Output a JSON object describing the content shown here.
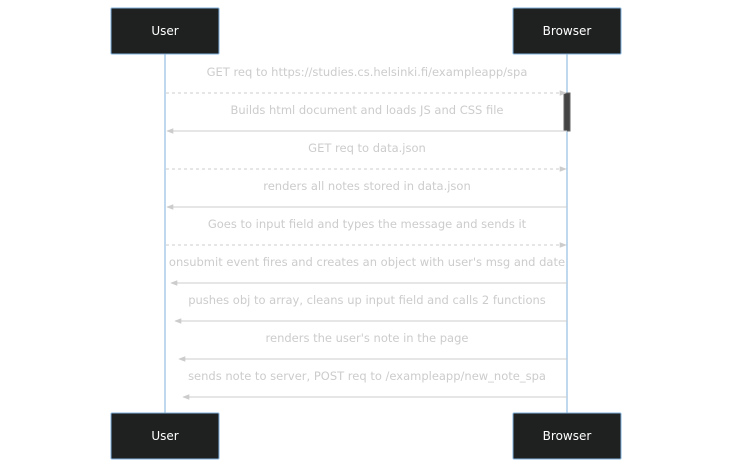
{
  "participants": [
    {
      "id": "user",
      "label": "User"
    },
    {
      "id": "browser",
      "label": "Browser"
    }
  ],
  "messages": [
    {
      "from": "user",
      "to": "browser",
      "style": "dotted",
      "text": "GET req to https://studies.cs.helsinki.fi/exampleapp/spa"
    },
    {
      "from": "browser",
      "to": "user",
      "style": "solid",
      "text": "Builds html document and loads JS and CSS file"
    },
    {
      "from": "user",
      "to": "browser",
      "style": "dotted",
      "text": "GET req to data.json"
    },
    {
      "from": "browser",
      "to": "user",
      "style": "solid",
      "text": "renders all notes stored in data.json"
    },
    {
      "from": "user",
      "to": "browser",
      "style": "dotted",
      "text": "Goes to input field and types the message and sends it"
    },
    {
      "from": "browser",
      "to": "user",
      "style": "solid",
      "text": "onsubmit event fires and creates an object with user's msg and date"
    },
    {
      "from": "browser",
      "to": "user",
      "style": "solid",
      "text": "pushes obj to array, cleans up input field and calls 2 functions"
    },
    {
      "from": "browser",
      "to": "user",
      "style": "solid",
      "text": "renders the user's note in the page"
    },
    {
      "from": "browser",
      "to": "user",
      "style": "solid",
      "text": "sends note to server, POST req to /exampleapp/new_note_spa"
    }
  ],
  "activation": {
    "participant": "browser",
    "from_message": 0,
    "to_message": 1
  },
  "colors": {
    "actor_fill": "#1f2020",
    "actor_border": "#81b1db",
    "lifeline": "#81b1db",
    "message": "#cccccc",
    "activation": "#444444"
  }
}
